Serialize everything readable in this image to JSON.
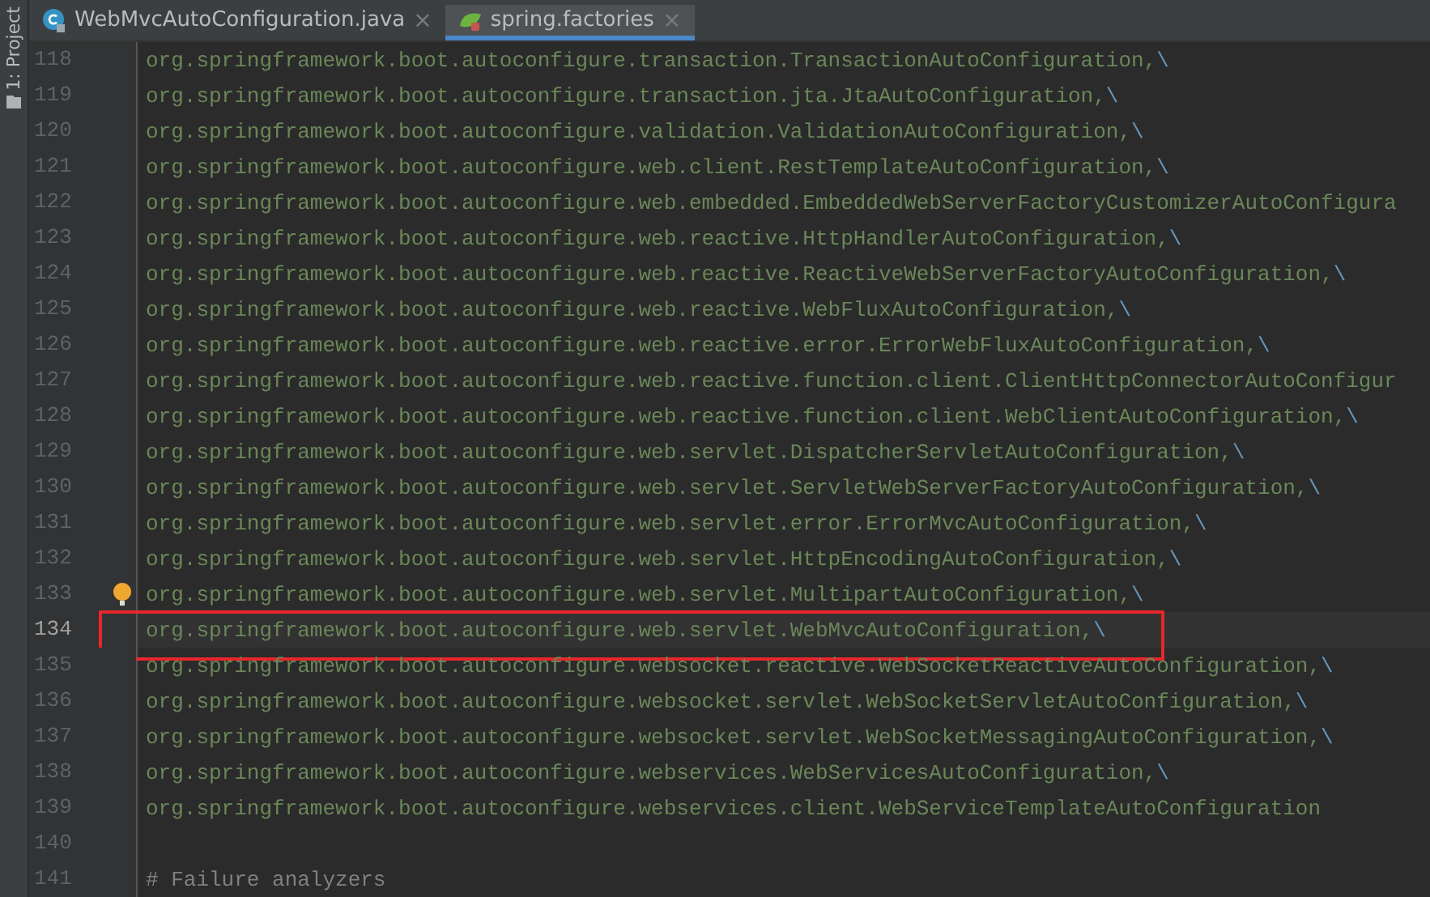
{
  "tool_strip": {
    "label": "1: Project"
  },
  "tabs": [
    {
      "label": "WebMvcAutoConfiguration.java",
      "kind": "class",
      "selected": false,
      "close": "×"
    },
    {
      "label": "spring.factories",
      "kind": "spring",
      "selected": true,
      "close": "×"
    }
  ],
  "lines": [
    {
      "number": "118",
      "kind": "code",
      "text": "org.springframework.boot.autoconfigure.transaction.TransactionAutoConfiguration,",
      "continuation": "\\"
    },
    {
      "number": "119",
      "kind": "code",
      "text": "org.springframework.boot.autoconfigure.transaction.jta.JtaAutoConfiguration,",
      "continuation": "\\"
    },
    {
      "number": "120",
      "kind": "code",
      "text": "org.springframework.boot.autoconfigure.validation.ValidationAutoConfiguration,",
      "continuation": "\\"
    },
    {
      "number": "121",
      "kind": "code",
      "text": "org.springframework.boot.autoconfigure.web.client.RestTemplateAutoConfiguration,",
      "continuation": "\\"
    },
    {
      "number": "122",
      "kind": "code",
      "text": "org.springframework.boot.autoconfigure.web.embedded.EmbeddedWebServerFactoryCustomizerAutoConfigura"
    },
    {
      "number": "123",
      "kind": "code",
      "text": "org.springframework.boot.autoconfigure.web.reactive.HttpHandlerAutoConfiguration,",
      "continuation": "\\"
    },
    {
      "number": "124",
      "kind": "code",
      "text": "org.springframework.boot.autoconfigure.web.reactive.ReactiveWebServerFactoryAutoConfiguration,",
      "continuation": "\\"
    },
    {
      "number": "125",
      "kind": "code",
      "text": "org.springframework.boot.autoconfigure.web.reactive.WebFluxAutoConfiguration,",
      "continuation": "\\"
    },
    {
      "number": "126",
      "kind": "code",
      "text": "org.springframework.boot.autoconfigure.web.reactive.error.ErrorWebFluxAutoConfiguration,",
      "continuation": "\\"
    },
    {
      "number": "127",
      "kind": "code",
      "text": "org.springframework.boot.autoconfigure.web.reactive.function.client.ClientHttpConnectorAutoConfigur"
    },
    {
      "number": "128",
      "kind": "code",
      "text": "org.springframework.boot.autoconfigure.web.reactive.function.client.WebClientAutoConfiguration,",
      "continuation": "\\"
    },
    {
      "number": "129",
      "kind": "code",
      "text": "org.springframework.boot.autoconfigure.web.servlet.DispatcherServletAutoConfiguration,",
      "continuation": "\\"
    },
    {
      "number": "130",
      "kind": "code",
      "text": "org.springframework.boot.autoconfigure.web.servlet.ServletWebServerFactoryAutoConfiguration,",
      "continuation": "\\"
    },
    {
      "number": "131",
      "kind": "code",
      "text": "org.springframework.boot.autoconfigure.web.servlet.error.ErrorMvcAutoConfiguration,",
      "continuation": "\\"
    },
    {
      "number": "132",
      "kind": "code",
      "text": "org.springframework.boot.autoconfigure.web.servlet.HttpEncodingAutoConfiguration,",
      "continuation": "\\"
    },
    {
      "number": "133",
      "kind": "code",
      "text": "org.springframework.boot.autoconfigure.web.servlet.MultipartAutoConfiguration,",
      "continuation": "\\",
      "bulb": true
    },
    {
      "number": "134",
      "kind": "code",
      "text": "org.springframework.boot.autoconfigure.web.servlet.WebMvcAutoConfiguration,",
      "continuation": "\\",
      "current": true,
      "boxed": true
    },
    {
      "number": "135",
      "kind": "code",
      "text": "org.springframework.boot.autoconfigure.websocket.reactive.WebSocketReactiveAutoConfiguration,",
      "continuation": "\\"
    },
    {
      "number": "136",
      "kind": "code",
      "text": "org.springframework.boot.autoconfigure.websocket.servlet.WebSocketServletAutoConfiguration,",
      "continuation": "\\"
    },
    {
      "number": "137",
      "kind": "code",
      "text": "org.springframework.boot.autoconfigure.websocket.servlet.WebSocketMessagingAutoConfiguration,",
      "continuation": "\\"
    },
    {
      "number": "138",
      "kind": "code",
      "text": "org.springframework.boot.autoconfigure.webservices.WebServicesAutoConfiguration,",
      "continuation": "\\"
    },
    {
      "number": "139",
      "kind": "code",
      "text": "org.springframework.boot.autoconfigure.webservices.client.WebServiceTemplateAutoConfiguration"
    },
    {
      "number": "140",
      "kind": "blank"
    },
    {
      "number": "141",
      "kind": "comment",
      "text": "# Failure analyzers"
    }
  ]
}
